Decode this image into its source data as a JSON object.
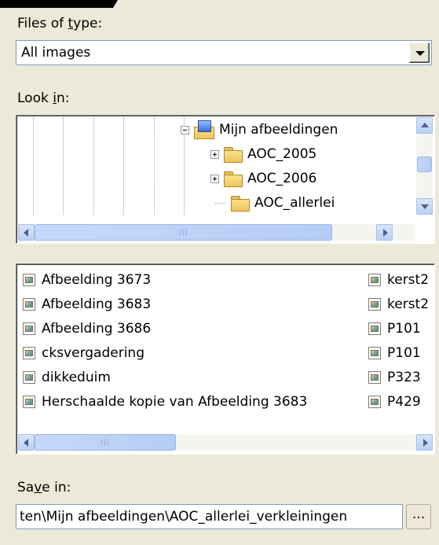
{
  "files_of_type": {
    "label_prefix": "Files of ",
    "label_underline": "t",
    "label_suffix": "ype:",
    "value": "All images"
  },
  "look_in": {
    "label_prefix": "Look ",
    "label_underline": "i",
    "label_suffix": "n:",
    "tree": [
      {
        "label": "Mijn afbeeldingen",
        "icon": "picture-folder-icon",
        "expander": "minus"
      },
      {
        "label": "AOC_2005",
        "icon": "folder-icon",
        "expander": "plus"
      },
      {
        "label": "AOC_2006",
        "icon": "folder-icon",
        "expander": "plus"
      },
      {
        "label": "AOC_allerlei",
        "icon": "folder-icon",
        "expander": "none"
      }
    ]
  },
  "files": {
    "left_column": [
      "Afbeelding 3673",
      "Afbeelding 3683",
      "Afbeelding 3686",
      "cksvergadering",
      "dikkeduim",
      "Herschaalde kopie van Afbeelding 3683"
    ],
    "right_column": [
      "kerst2",
      "kerst2",
      "P101",
      "P101",
      "P323",
      "P429"
    ]
  },
  "save_in": {
    "label_prefix": "Sa",
    "label_underline": "v",
    "label_suffix": "e in:",
    "value": "ten\\Mijn afbeeldingen\\AOC_allerlei_verkleiningen",
    "browse_label": "..."
  },
  "colors": {
    "dialog_bg": "#ece9d8",
    "field_border": "#7f9db9",
    "scroll_blue": "#b9d0f6"
  }
}
